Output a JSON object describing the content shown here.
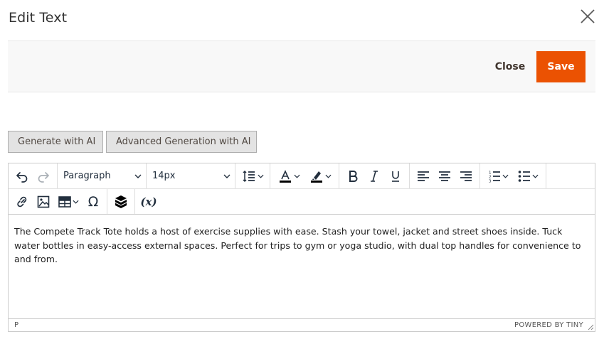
{
  "modal": {
    "title": "Edit Text",
    "close_icon": "close-icon"
  },
  "actions": {
    "close_label": "Close",
    "save_label": "Save",
    "accent_color": "#eb5202"
  },
  "ai_buttons": {
    "generate_label": "Generate with AI",
    "advanced_label": "Advanced Generation with AI"
  },
  "toolbar": {
    "block_format": "Paragraph",
    "font_size": "14px",
    "icons_row1": [
      "undo-icon",
      "redo-icon",
      "line-height-icon",
      "text-color-icon",
      "highlight-icon",
      "bold-icon",
      "italic-icon",
      "underline-icon",
      "align-left-icon",
      "align-center-icon",
      "align-right-icon",
      "numbered-list-icon",
      "bullet-list-icon"
    ],
    "icons_row2": [
      "link-icon",
      "image-icon",
      "table-icon",
      "special-char-icon",
      "widget-icon",
      "variable-icon"
    ],
    "variable_label": "(x)",
    "omega_label": "Ω"
  },
  "editor": {
    "content": "The Compete Track Tote holds a host of exercise supplies with ease. Stash your towel, jacket and street shoes inside. Tuck water bottles in easy-access external spaces. Perfect for trips to gym or yoga studio, with dual top handles for convenience to and from."
  },
  "statusbar": {
    "path": "P",
    "powered_by": "POWERED BY TINY"
  }
}
